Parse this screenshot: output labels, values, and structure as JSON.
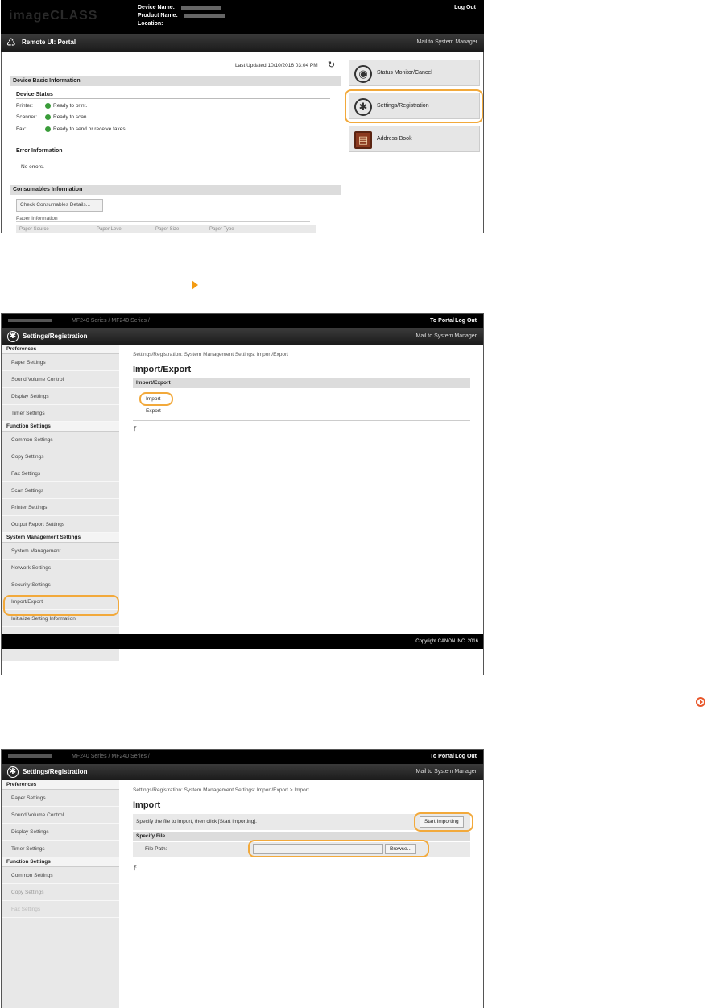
{
  "shot1": {
    "logo": "imageCLASS",
    "device_name_label": "Device Name:",
    "product_name_label": "Product Name:",
    "location_label": "Location:",
    "logout": "Log Out",
    "title": "Remote UI: Portal",
    "mail_link": "Mail to System Manager",
    "last_updated": "Last Updated:10/10/2016 03:04 PM",
    "device_basic_info": "Device Basic Information",
    "device_status": "Device Status",
    "status_rows": [
      {
        "label": "Printer:",
        "text": "Ready to print."
      },
      {
        "label": "Scanner:",
        "text": "Ready to scan."
      },
      {
        "label": "Fax:",
        "text": "Ready to send or receive faxes."
      }
    ],
    "error_info": "Error Information",
    "no_errors": "No errors.",
    "consumables_info": "Consumables Information",
    "check_consumables": "Check Consumables Details...",
    "paper_info": "Paper Information",
    "paper_columns": [
      "Paper Source",
      "Paper Level",
      "Paper Size",
      "Paper Type"
    ],
    "menu": [
      {
        "label": "Status Monitor/Cancel",
        "icon": "eye-icon"
      },
      {
        "label": "Settings/Registration",
        "icon": "settings-icon"
      },
      {
        "label": "Address Book",
        "icon": "book-icon"
      }
    ],
    "highlight_color": "#f2a93b"
  },
  "shot2": {
    "crumb": "MF240 Series / MF240 Series /",
    "to_portal": "To Portal",
    "logout": "Log Out",
    "title": "Settings/Registration",
    "mail_link": "Mail to System Manager",
    "sidebar": {
      "preferences": "Preferences",
      "pref_items": [
        "Paper Settings",
        "Sound Volume Control",
        "Display Settings",
        "Timer Settings"
      ],
      "function": "Function Settings",
      "func_items": [
        "Common Settings",
        "Copy Settings",
        "Fax Settings",
        "Scan Settings",
        "Printer Settings",
        "Output Report Settings"
      ],
      "system": "System Management Settings",
      "sys_items": [
        "System Management",
        "Network Settings",
        "Security Settings",
        "Import/Export",
        "Initialize Setting Information"
      ]
    },
    "breadcrumb": "Settings/Registration: System Management Settings: Import/Export",
    "page_title": "Import/Export",
    "table_head": "Import/Export",
    "links": [
      "Import",
      "Export"
    ],
    "footer": "Copyright CANON INC. 2016"
  },
  "shot3": {
    "crumb": "MF240 Series / MF240 Series /",
    "to_portal": "To Portal",
    "logout": "Log Out",
    "title": "Settings/Registration",
    "mail_link": "Mail to System Manager",
    "sidebar": {
      "preferences": "Preferences",
      "pref_items": [
        "Paper Settings",
        "Sound Volume Control",
        "Display Settings",
        "Timer Settings"
      ],
      "function": "Function Settings",
      "func_items": [
        "Common Settings",
        "Copy Settings",
        "Fax Settings"
      ]
    },
    "breadcrumb": "Settings/Registration: System Management Settings: Import/Export > Import",
    "page_title": "Import",
    "instruction": "Specify the file to import, then click [Start Importing].",
    "start_button": "Start Importing",
    "specify_file": "Specify File",
    "file_path_label": "File Path:",
    "file_path_value": "",
    "browse_button": "Browse..."
  }
}
